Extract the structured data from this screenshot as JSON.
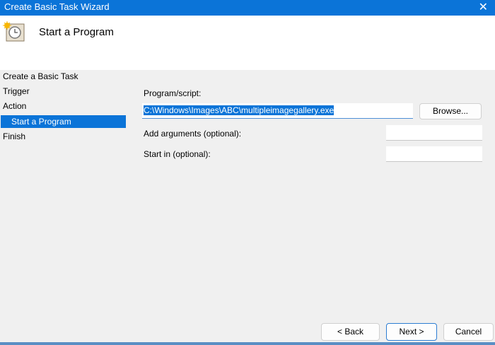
{
  "window": {
    "title": "Create Basic Task Wizard",
    "close_icon": "close-icon"
  },
  "header": {
    "title": "Start a Program",
    "icon": "task-scheduler-clock-icon"
  },
  "sidebar": {
    "items": [
      {
        "label": "Create a Basic Task"
      },
      {
        "label": "Trigger"
      },
      {
        "label": "Action"
      },
      {
        "label": "Start a Program",
        "selected": true
      },
      {
        "label": "Finish"
      }
    ]
  },
  "form": {
    "program_label": "Program/script:",
    "program_value": "C:\\Windows\\Images\\ABC\\multipleimagegallery.exe",
    "browse_label": "Browse...",
    "args_label": "Add arguments (optional):",
    "args_value": "",
    "startin_label": "Start in (optional):",
    "startin_value": ""
  },
  "footer": {
    "back_label": "< Back",
    "next_label": "Next >",
    "cancel_label": "Cancel"
  }
}
